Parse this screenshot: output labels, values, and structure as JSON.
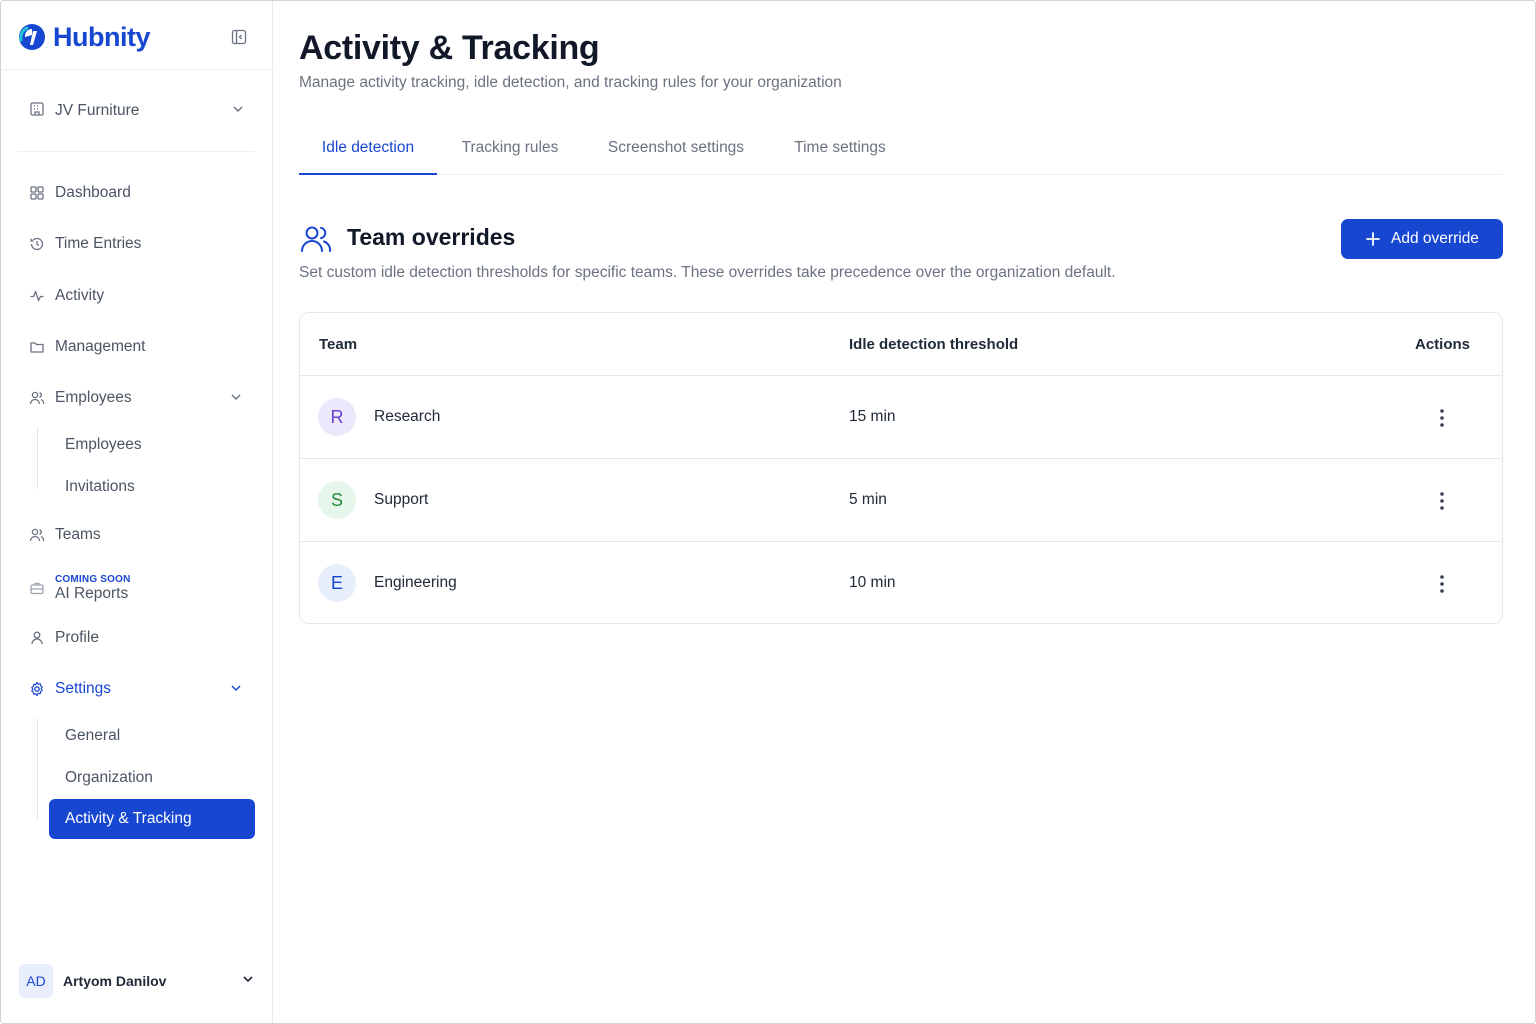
{
  "app": {
    "brand_name": "Hubnity",
    "accent": "#1746d1"
  },
  "sidebar": {
    "org": {
      "name": "JV Furniture",
      "icon": "building-icon"
    },
    "items": [
      {
        "label": "Dashboard",
        "icon": "grid-icon"
      },
      {
        "label": "Time Entries",
        "icon": "history-icon"
      },
      {
        "label": "Activity",
        "icon": "activity-icon"
      },
      {
        "label": "Management",
        "icon": "folder-icon"
      },
      {
        "label": "Employees",
        "icon": "users-icon"
      },
      {
        "label": "Teams",
        "icon": "users-icon"
      },
      {
        "label": "AI Reports",
        "icon": "briefcase-icon",
        "badge": "COMING SOON"
      },
      {
        "label": "Profile",
        "icon": "user-icon"
      },
      {
        "label": "Settings",
        "icon": "gear-icon"
      }
    ],
    "employees_sub": [
      "Employees",
      "Invitations"
    ],
    "settings_sub": [
      "General",
      "Organization",
      "Activity & Tracking"
    ],
    "user": {
      "initials": "AD",
      "name": "Artyom Danilov"
    }
  },
  "main": {
    "title": "Activity & Tracking",
    "subtitle": "Manage activity tracking, idle detection, and tracking rules for your organization",
    "tabs": [
      {
        "label": "Idle detection",
        "active": true
      },
      {
        "label": "Tracking rules",
        "active": false
      },
      {
        "label": "Screenshot settings",
        "active": false
      },
      {
        "label": "Time settings",
        "active": false
      }
    ],
    "section": {
      "title": "Team overrides",
      "description": "Set custom idle detection thresholds for specific teams. These overrides take precedence over the organization default.",
      "add_label": "Add override"
    },
    "table": {
      "columns": [
        "Team",
        "Idle detection threshold",
        "Actions"
      ],
      "rows": [
        {
          "initial": "R",
          "team": "Research",
          "threshold": "15 min",
          "avatar_bg": "#ede7fb",
          "avatar_fg": "#6d3fd1"
        },
        {
          "initial": "S",
          "team": "Support",
          "threshold": "5 min",
          "avatar_bg": "#e6f6ea",
          "avatar_fg": "#1f8a3b"
        },
        {
          "initial": "E",
          "team": "Engineering",
          "threshold": "10 min",
          "avatar_bg": "#e7eefc",
          "avatar_fg": "#1746d1"
        }
      ]
    }
  }
}
